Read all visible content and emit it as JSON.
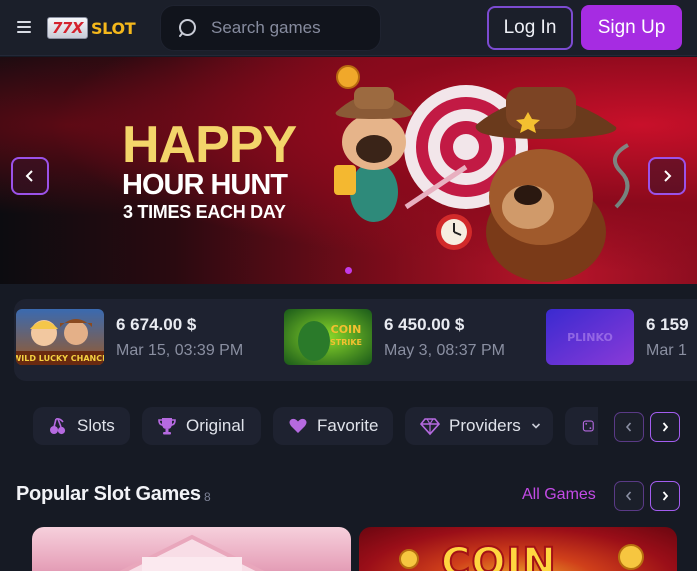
{
  "header": {
    "logo_number": "77X",
    "logo_text": "SLOT",
    "search_placeholder": "Search games",
    "login_label": "Log In",
    "signup_label": "Sign Up"
  },
  "banner": {
    "title": "HAPPY",
    "subtitle": "HOUR HUNT",
    "tagline": "3 TIMES EACH DAY",
    "active_slide": 1
  },
  "recent_wins": [
    {
      "game": "WILD LUCKY CHANCE",
      "amount": "6 674.00 $",
      "date": "Mar 15, 03:39 PM"
    },
    {
      "game": "COIN STRIKE",
      "amount": "6 450.00 $",
      "date": "May 3, 08:37 PM"
    },
    {
      "game": "PLINKO",
      "amount": "6 159",
      "date": "Mar 1"
    }
  ],
  "categories": [
    {
      "label": "Slots",
      "icon": "cherries-icon"
    },
    {
      "label": "Original",
      "icon": "trophy-icon"
    },
    {
      "label": "Favorite",
      "icon": "heart-icon"
    },
    {
      "label": "Providers",
      "icon": "diamond-icon"
    }
  ],
  "section": {
    "title": "Popular Slot Games",
    "count": "8",
    "all_link": "All Games"
  },
  "games": [
    {
      "name": "Pink slot"
    },
    {
      "name": "COIN"
    }
  ],
  "colors": {
    "accent": "#a62ce2",
    "accent_border": "#7c4bd1",
    "link": "#c34be6",
    "banner_title": "#f3d56a",
    "background": "#161a24",
    "panel": "#1e2230"
  }
}
